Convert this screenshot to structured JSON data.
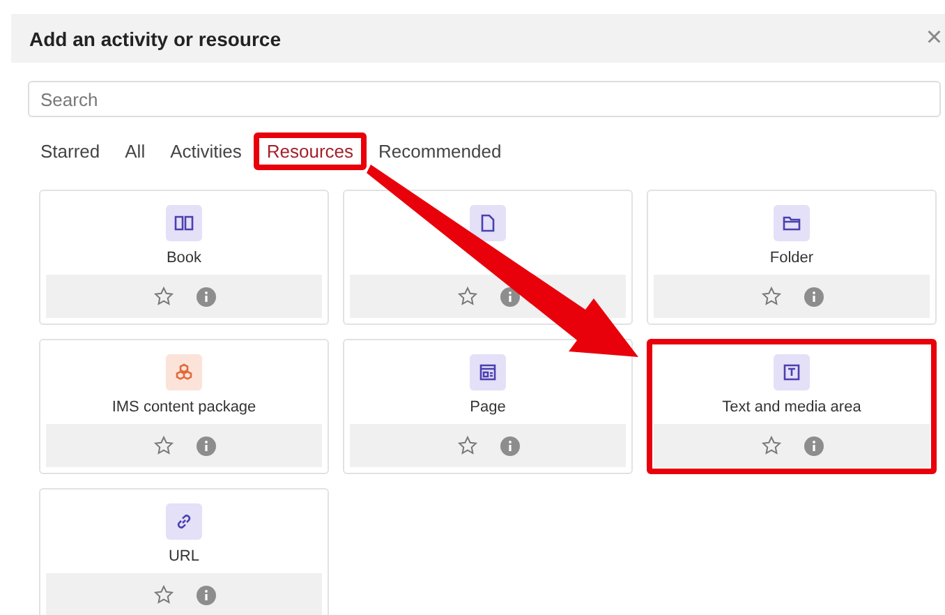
{
  "dialog": {
    "title": "Add an activity or resource",
    "close": "×"
  },
  "search": {
    "placeholder": "Search"
  },
  "tabs": [
    {
      "label": "Starred",
      "selected": false,
      "highlighted": false
    },
    {
      "label": "All",
      "selected": false,
      "highlighted": false
    },
    {
      "label": "Activities",
      "selected": false,
      "highlighted": false
    },
    {
      "label": "Resources",
      "selected": true,
      "highlighted": true
    },
    {
      "label": "Recommended",
      "selected": false,
      "highlighted": false
    }
  ],
  "cards": [
    {
      "kind": "book",
      "color": "#e3e0f7",
      "name": "Book",
      "starred": false,
      "highlighted": false
    },
    {
      "kind": "file",
      "color": "#e3e0f7",
      "starred": false,
      "highlighted": false
    },
    {
      "kind": "folder",
      "color": "#e3e0f7",
      "name": "Folder",
      "starred": false,
      "highlighted": false
    },
    {
      "kind": "package",
      "color": "#fbe3da",
      "name": "IMS content package",
      "starred": false,
      "highlighted": false
    },
    {
      "kind": "page",
      "color": "#e3e0f7",
      "name": "Page",
      "starred": false,
      "highlighted": false
    },
    {
      "kind": "text",
      "color": "#e3e0f7",
      "name": "Text and media area",
      "starred": false,
      "highlighted": true
    },
    {
      "kind": "link",
      "color": "#e3e0f7",
      "name": "URL",
      "starred": false,
      "highlighted": false
    }
  ]
}
